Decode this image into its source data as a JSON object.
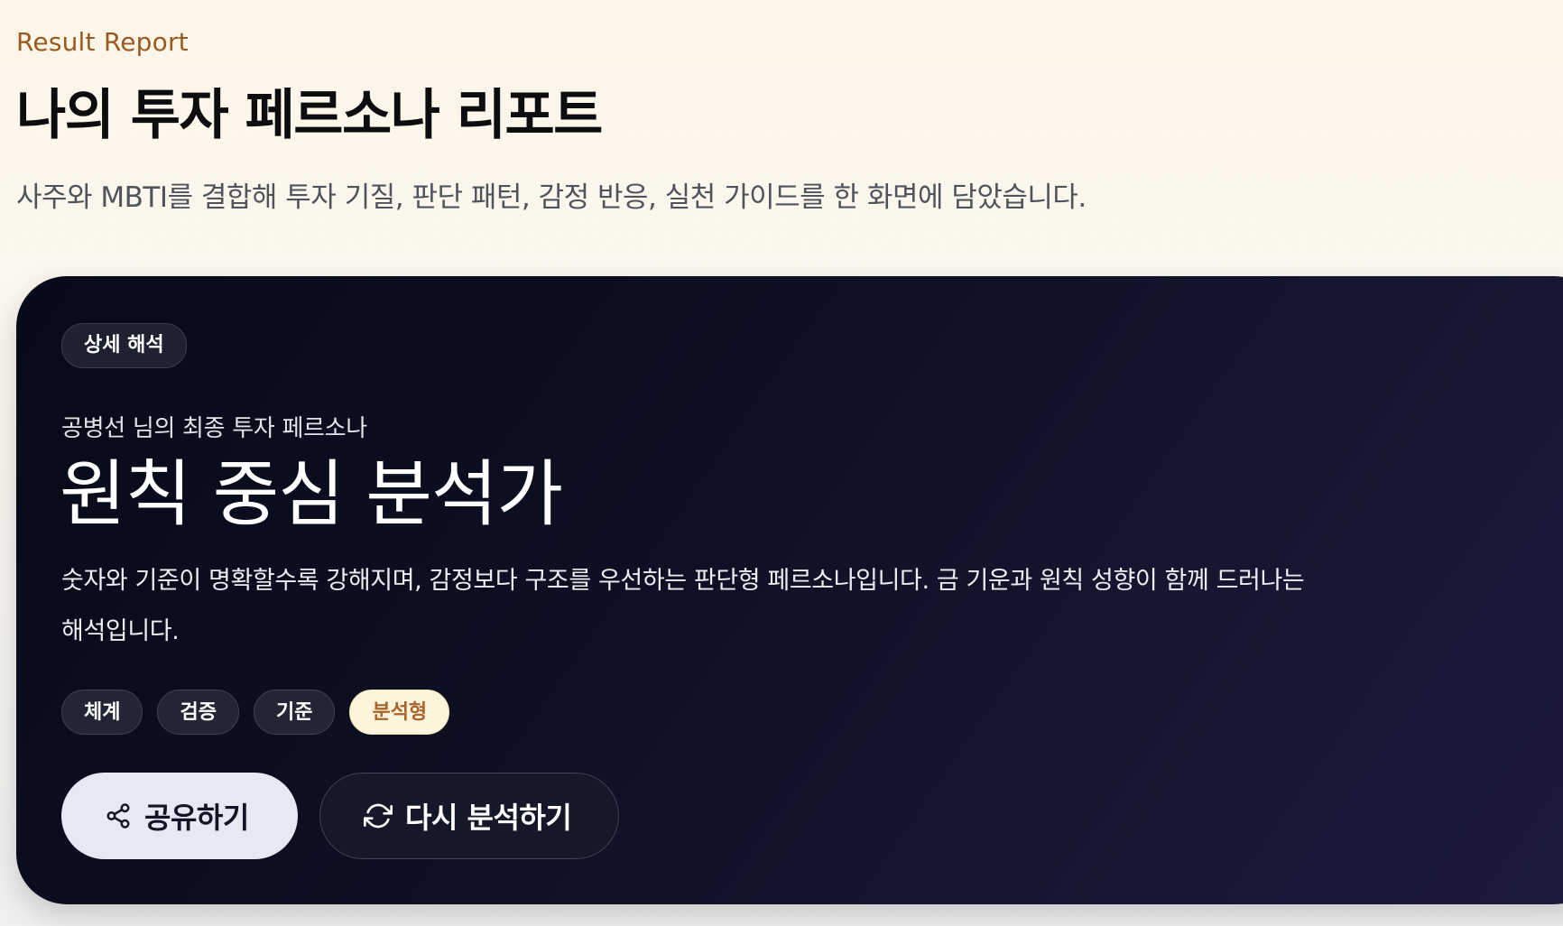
{
  "header": {
    "eyebrow": "Result Report",
    "title": "나의 투자 페르소나 리포트",
    "subtitle": "사주와 MBTI를 결합해 투자 기질, 판단 패턴, 감정 반응, 실천 가이드를 한 화면에 담았습니다."
  },
  "hero": {
    "badge": "상세 해석",
    "owner_line": "공병선 님의 최종 투자 페르소나",
    "persona_name": "원칙 중심 분석가",
    "description": "숫자와 기준이 명확할수록 강해지며, 감정보다 구조를 우선하는 판단형 페르소나입니다. 금 기운과 원칙 성향이 함께 드러나는 해석입니다.",
    "tags": [
      "체계",
      "검증",
      "기준",
      "분석형"
    ],
    "actions": {
      "share_label": "공유하기",
      "share_icon": "share-icon",
      "reanalyze_label": "다시 분석하기",
      "reanalyze_icon": "refresh-icon"
    }
  },
  "colors": {
    "eyebrow": "#9a5a1f",
    "card_background": "#0b0e1f",
    "highlight_tag_bg": "#fdf4dc",
    "highlight_tag_text": "#a8652b",
    "share_button_bg": "#e6e8f3"
  }
}
